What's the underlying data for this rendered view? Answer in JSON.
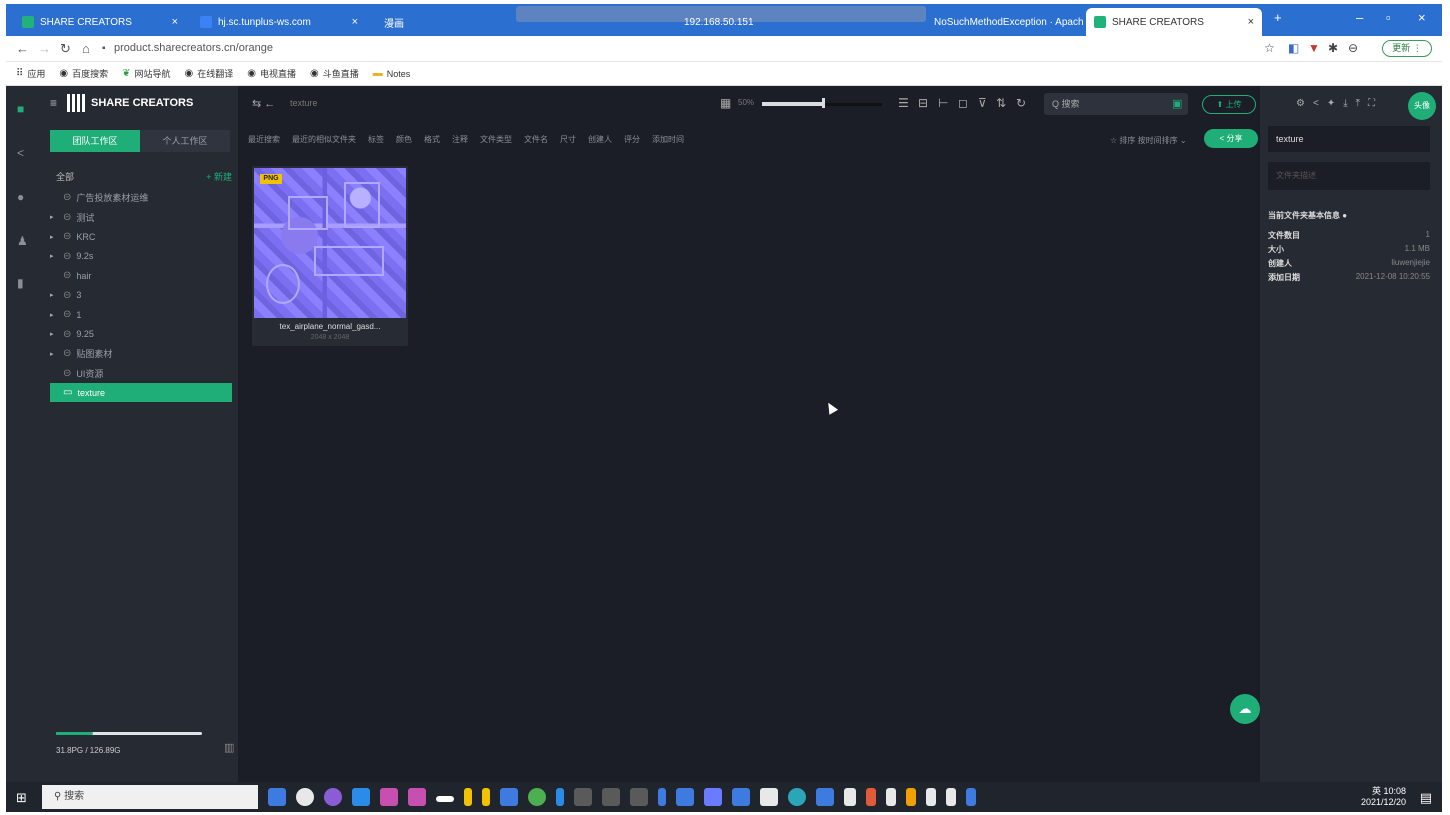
{
  "browser": {
    "tabs": [
      {
        "title": "SHARE CREATORS",
        "active": false
      },
      {
        "title": "hj.sc.tunplus-ws.com",
        "active": false
      },
      {
        "title": "漫画",
        "active": false
      },
      {
        "title": "192.168.50.151",
        "active": false
      },
      {
        "title": "NoSuchMethodException · Apach",
        "active": false
      },
      {
        "title": "SHARE CREATORS",
        "active": true
      }
    ],
    "new_tab": "+",
    "url": "product.sharecreators.cn/orange",
    "update_label": "更新 ⋮",
    "bookmarks": [
      "应用",
      "百度搜索",
      "网站导航",
      "在线翻译",
      "电视直播",
      "斗鱼直播",
      "Notes"
    ]
  },
  "app": {
    "brand": "SHARE CREATORS",
    "workspace_tabs": [
      "团队工作区",
      "个人工作区"
    ],
    "tree_root": "全部",
    "new_folder": "+ 新建",
    "tree": [
      {
        "label": "广告投放素材运维",
        "arrow": false,
        "icon": "folder",
        "selected": false
      },
      {
        "label": "测试",
        "arrow": true,
        "icon": "folder",
        "selected": false
      },
      {
        "label": "KRC",
        "arrow": true,
        "icon": "folder",
        "selected": false
      },
      {
        "label": "9.2s",
        "arrow": true,
        "icon": "folder",
        "selected": false
      },
      {
        "label": "hair",
        "arrow": false,
        "icon": "folder",
        "selected": false
      },
      {
        "label": "3",
        "arrow": true,
        "icon": "folder",
        "selected": false
      },
      {
        "label": "1",
        "arrow": true,
        "icon": "folder",
        "selected": false
      },
      {
        "label": "9.25",
        "arrow": true,
        "icon": "folder",
        "selected": false
      },
      {
        "label": "贴图素材",
        "arrow": true,
        "icon": "folder",
        "selected": false
      },
      {
        "label": "UI资源",
        "arrow": false,
        "icon": "folder",
        "selected": false
      },
      {
        "label": "texture",
        "arrow": false,
        "icon": "folder-open",
        "selected": true
      }
    ],
    "storage_text": "31.8PG / 126.89G",
    "storage_fraction": 0.25,
    "toolbar": {
      "crumb": "texture",
      "zoom_label": "50%",
      "zoom_fraction": 0.5,
      "search_placeholder": "Q 搜索",
      "upload_label": "⬆ 上传"
    },
    "filters": [
      "最近搜索",
      "最近的相似文件夹",
      "标签",
      "颜色",
      "格式",
      "注释",
      "文件类型",
      "文件名",
      "尺寸",
      "创建人",
      "评分",
      "添加时间"
    ],
    "sort_label": "☆ 排序  按时间排序 ⌄",
    "share_label": "< 分享",
    "file": {
      "badge": "PNG",
      "name": "tex_airplane_normal_gasd...",
      "meta": "2048 x 2048"
    },
    "right_panel": {
      "folder_name": "texture",
      "desc_placeholder": "文件夹描述",
      "section_title": "当前文件夹基本信息 ●",
      "rows": [
        {
          "label": "文件数目",
          "value": "1"
        },
        {
          "label": "大小",
          "value": "1.1 MB"
        },
        {
          "label": "创建人",
          "value": "liuwenjiejie"
        },
        {
          "label": "添加日期",
          "value": "2021-12-08 10:20:55"
        }
      ],
      "avatar": "头像"
    }
  },
  "taskbar": {
    "search": "搜索",
    "time": "10:08",
    "date": "2021/12/20",
    "lang": "英"
  }
}
